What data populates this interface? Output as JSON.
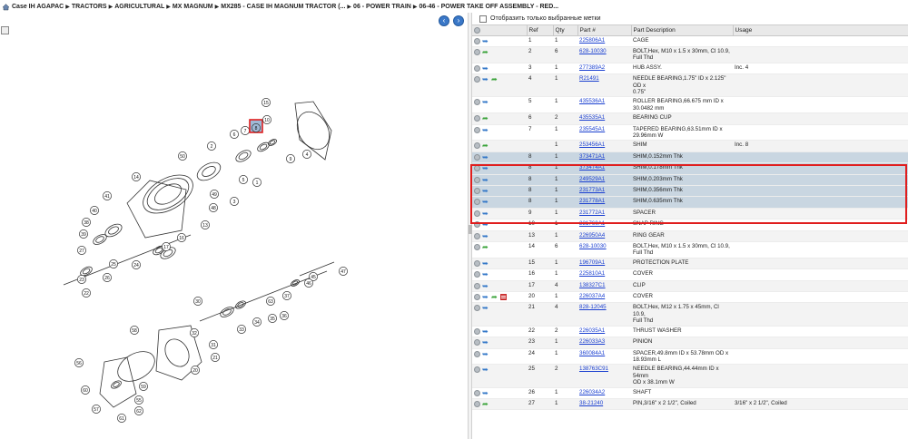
{
  "breadcrumb": {
    "items": [
      "Case IH AGAPAC",
      "TRACTORS",
      "AGRICULTURAL",
      "MX MAGNUM",
      "MX285 - CASE IH MAGNUM TRACTOR (...",
      "06 - POWER TRAIN",
      "06-46 - POWER TAKE OFF ASSEMBLY - RED..."
    ]
  },
  "filter": {
    "label": "Отобразить только выбранные метки"
  },
  "table": {
    "columns": [
      "Ref",
      "Qty",
      "Part #",
      "Part Description",
      "Usage"
    ],
    "rows": [
      {
        "ref": "1",
        "qty": "1",
        "part": "225806A1",
        "desc": [
          "CAGE"
        ],
        "usage": "",
        "icons": [
          "circle",
          "blue"
        ],
        "sel": false
      },
      {
        "ref": "2",
        "qty": "6",
        "part": "628-10030",
        "desc": [
          "BOLT,Hex, M10 x 1.5 x 30mm, Cl 10.9,",
          "Full Thd"
        ],
        "usage": "",
        "icons": [
          "circle",
          "green"
        ],
        "sel": false
      },
      {
        "ref": "3",
        "qty": "1",
        "part": "277389A2",
        "desc": [
          "HUB ASSY."
        ],
        "usage": "Inc. 4",
        "icons": [
          "circle",
          "blue"
        ],
        "sel": false
      },
      {
        "ref": "4",
        "qty": "1",
        "part": "R21491",
        "desc": [
          "NEEDLE BEARING,1.75\" ID x 2.125\" OD x",
          "0.75\""
        ],
        "usage": "",
        "icons": [
          "circle",
          "blue",
          "green"
        ],
        "sel": false
      },
      {
        "ref": "5",
        "qty": "1",
        "part": "435536A1",
        "desc": [
          "ROLLER BEARING,66.675 mm ID x",
          "30.0482 mm"
        ],
        "usage": "",
        "icons": [
          "circle",
          "blue"
        ],
        "sel": false
      },
      {
        "ref": "6",
        "qty": "2",
        "part": "435535A1",
        "desc": [
          "BEARING CUP"
        ],
        "usage": "",
        "icons": [
          "circle",
          "green"
        ],
        "sel": false
      },
      {
        "ref": "7",
        "qty": "1",
        "part": "235545A1",
        "desc": [
          "TAPERED BEARING,63.51mm ID x",
          "29.96mm W"
        ],
        "usage": "",
        "icons": [
          "circle",
          "blue"
        ],
        "sel": false
      },
      {
        "ref": "",
        "qty": "1",
        "part": "253456A1",
        "desc": [
          "SHIM"
        ],
        "usage": "Inc. 8",
        "icons": [
          "circle",
          "green"
        ],
        "sel": false
      },
      {
        "ref": "8",
        "qty": "1",
        "part": "373471A1",
        "desc": [
          "SHIM,0.152mm Thk"
        ],
        "usage": "",
        "icons": [
          "circle",
          "blue"
        ],
        "sel": true
      },
      {
        "ref": "8",
        "qty": "1",
        "part": "373474A1",
        "desc": [
          "SHIM,0.178mm Thk"
        ],
        "usage": "",
        "icons": [
          "circle",
          "blue"
        ],
        "sel": true
      },
      {
        "ref": "8",
        "qty": "1",
        "part": "249529A1",
        "desc": [
          "SHIM,0.203mm Thk"
        ],
        "usage": "",
        "icons": [
          "circle",
          "blue"
        ],
        "sel": true
      },
      {
        "ref": "8",
        "qty": "1",
        "part": "231773A1",
        "desc": [
          "SHIM,0.356mm Thk"
        ],
        "usage": "",
        "icons": [
          "circle",
          "blue"
        ],
        "sel": true
      },
      {
        "ref": "8",
        "qty": "1",
        "part": "231778A1",
        "desc": [
          "SHIM,0.635mm Thk"
        ],
        "usage": "",
        "icons": [
          "circle",
          "blue"
        ],
        "sel": true
      },
      {
        "ref": "9",
        "qty": "1",
        "part": "231772A1",
        "desc": [
          "SPACER"
        ],
        "usage": "",
        "icons": [
          "circle",
          "blue"
        ],
        "sel": false
      },
      {
        "ref": "10",
        "qty": "1",
        "part": "231760A1",
        "desc": [
          "SNAP RING"
        ],
        "usage": "",
        "icons": [
          "circle",
          "blue"
        ],
        "sel": false
      },
      {
        "ref": "13",
        "qty": "1",
        "part": "226950A4",
        "desc": [
          "RING GEAR"
        ],
        "usage": "",
        "icons": [
          "circle",
          "blue"
        ],
        "sel": false
      },
      {
        "ref": "14",
        "qty": "6",
        "part": "628-10030",
        "desc": [
          "BOLT,Hex, M10 x 1.5 x 30mm, Cl 10.9,",
          "Full Thd"
        ],
        "usage": "",
        "icons": [
          "circle",
          "green"
        ],
        "sel": false
      },
      {
        "ref": "15",
        "qty": "1",
        "part": "196709A1",
        "desc": [
          "PROTECTION PLATE"
        ],
        "usage": "",
        "icons": [
          "circle",
          "blue"
        ],
        "sel": false
      },
      {
        "ref": "16",
        "qty": "1",
        "part": "225810A1",
        "desc": [
          "COVER"
        ],
        "usage": "",
        "icons": [
          "circle",
          "blue"
        ],
        "sel": false
      },
      {
        "ref": "17",
        "qty": "4",
        "part": "138327C1",
        "desc": [
          "CLIP"
        ],
        "usage": "",
        "icons": [
          "circle",
          "blue"
        ],
        "sel": false
      },
      {
        "ref": "20",
        "qty": "1",
        "part": "226037A4",
        "desc": [
          "COVER"
        ],
        "usage": "",
        "icons": [
          "circle",
          "blue",
          "green",
          "red"
        ],
        "sel": false
      },
      {
        "ref": "21",
        "qty": "4",
        "part": "828-12045",
        "desc": [
          "BOLT,Hex, M12 x 1.75 x 45mm, Cl 10.9,",
          "Full Thd"
        ],
        "usage": "",
        "icons": [
          "circle",
          "blue"
        ],
        "sel": false
      },
      {
        "ref": "22",
        "qty": "2",
        "part": "226035A1",
        "desc": [
          "THRUST WASHER"
        ],
        "usage": "",
        "icons": [
          "circle",
          "blue"
        ],
        "sel": false
      },
      {
        "ref": "23",
        "qty": "1",
        "part": "226033A3",
        "desc": [
          "PINION"
        ],
        "usage": "",
        "icons": [
          "circle",
          "blue"
        ],
        "sel": false
      },
      {
        "ref": "24",
        "qty": "1",
        "part": "360084A1",
        "desc": [
          "SPACER,49.8mm ID x 53.78mm OD x",
          "18.93mm L"
        ],
        "usage": "",
        "icons": [
          "circle",
          "blue"
        ],
        "sel": false
      },
      {
        "ref": "25",
        "qty": "2",
        "part": "138763C91",
        "desc": [
          "NEEDLE BEARING,44.44mm ID x 54mm",
          "OD x 38.1mm W"
        ],
        "usage": "",
        "icons": [
          "circle",
          "blue"
        ],
        "sel": false
      },
      {
        "ref": "26",
        "qty": "1",
        "part": "226034A2",
        "desc": [
          "SHAFT"
        ],
        "usage": "",
        "icons": [
          "circle",
          "blue"
        ],
        "sel": false
      },
      {
        "ref": "27",
        "qty": "1",
        "part": "38-21240",
        "desc": [
          "PIN,3/16\" x 2 1/2\", Coiled"
        ],
        "usage": "3/16\" x 2 1/2\", Coiled",
        "icons": [
          "circle",
          "green"
        ],
        "sel": false
      }
    ]
  },
  "diagram": {
    "callouts": [
      "1",
      "2",
      "3",
      "4",
      "5",
      "6",
      "7",
      "8",
      "9",
      "10",
      "13",
      "14",
      "15",
      "16",
      "17",
      "20",
      "21",
      "22",
      "23",
      "24",
      "25",
      "26",
      "27",
      "30",
      "31",
      "32",
      "33",
      "34",
      "35",
      "36",
      "37",
      "38",
      "39",
      "40",
      "41",
      "45",
      "46",
      "47",
      "48",
      "49",
      "50",
      "55",
      "56",
      "57",
      "58",
      "59",
      "60",
      "61",
      "62",
      "63"
    ],
    "highlighted_callout": "8"
  },
  "colors": {
    "selection_bg": "#c9d6e1",
    "highlight_border": "#e01e1e",
    "link": "#1a3fd0"
  }
}
